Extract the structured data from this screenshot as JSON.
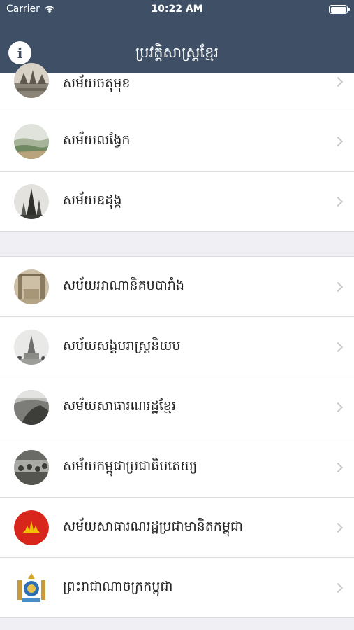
{
  "status_bar": {
    "carrier": "Carrier",
    "time": "10:22 AM",
    "battery_level": 1.0
  },
  "header": {
    "title": "ប្រវត្តិសាស្ត្រខ្មែរ",
    "info_icon": "info-icon"
  },
  "sections": [
    {
      "items": [
        {
          "label": "សម័យចតុមុខ",
          "thumb": "sepia-temple-photo"
        },
        {
          "label": "សម័យលង្វែក",
          "thumb": "landscape-painting"
        },
        {
          "label": "សម័យឧដុង្គ",
          "thumb": "stupa-photo"
        }
      ]
    },
    {
      "items": [
        {
          "label": "សម័យអាណានិគមបារាំង",
          "thumb": "colonial-era-photo"
        },
        {
          "label": "សម័យសង្គមរាស្ត្រនិយម",
          "thumb": "monument-photo"
        },
        {
          "label": "សម័យសាធារណរដ្ឋខ្មែរ",
          "thumb": "republic-era-photo"
        },
        {
          "label": "សម័យកម្ពុជាប្រជាធិបតេយ្យ",
          "thumb": "crowd-photo"
        },
        {
          "label": "សម័យសាធារណរដ្ឋប្រជាមានិតកម្ពុជា",
          "thumb": "prk-flag-emblem"
        },
        {
          "label": "ព្រះរាជាណាចក្រកម្ពុជា",
          "thumb": "royal-coat-of-arms"
        }
      ]
    }
  ],
  "colors": {
    "nav_bar": "#3e4f66",
    "background": "#efeff4",
    "chevron": "#c7c7cc",
    "prk_red": "#d9261c",
    "prk_yellow": "#f2c200"
  }
}
